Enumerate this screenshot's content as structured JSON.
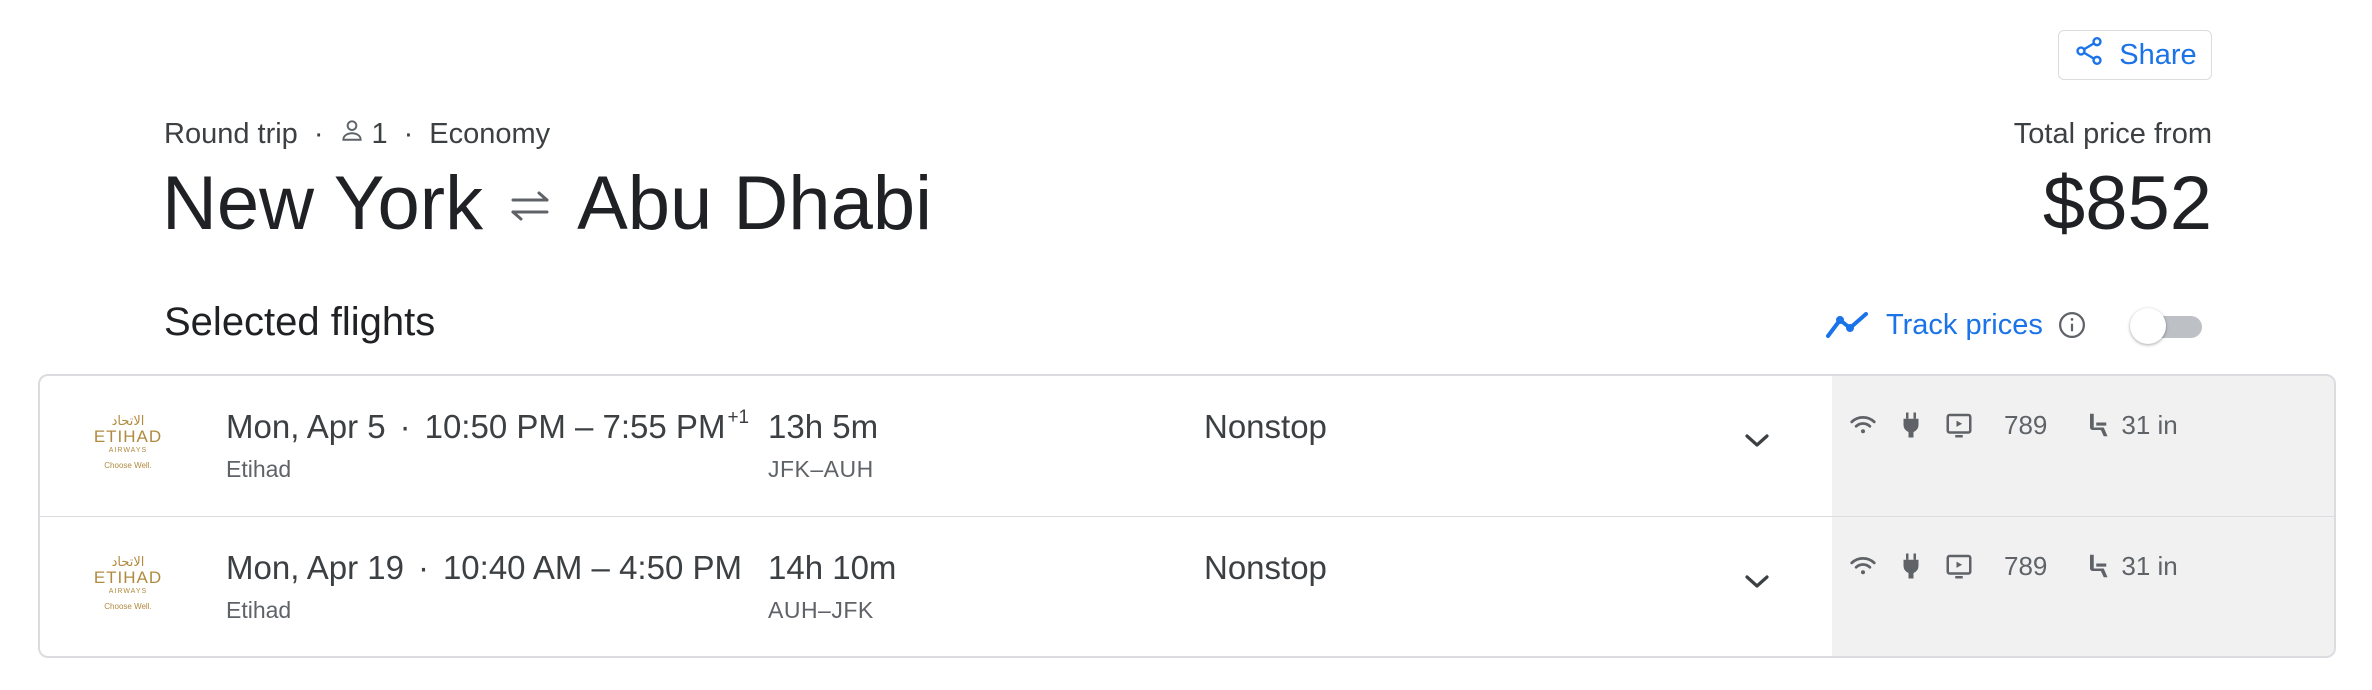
{
  "header": {
    "share_label": "Share",
    "trip_type": "Round trip",
    "passengers": "1",
    "cabin": "Economy",
    "origin": "New York",
    "destination": "Abu Dhabi",
    "total_label": "Total price from",
    "total_price": "$852"
  },
  "section": {
    "title": "Selected flights",
    "track_label": "Track prices",
    "track_enabled": false
  },
  "flights": [
    {
      "logo": {
        "arabic": "الاتحاد",
        "brand": "ETIHAD",
        "sub": "AIRWAYS",
        "tag": "Choose Well."
      },
      "date": "Mon, Apr 5",
      "times": "10:50 PM – 7:55 PM",
      "day_offset": "+1",
      "airline": "Etihad",
      "duration": "13h 5m",
      "route": "JFK–AUH",
      "stops": "Nonstop",
      "aircraft": "789",
      "legroom": "31 in"
    },
    {
      "logo": {
        "arabic": "الاتحاد",
        "brand": "ETIHAD",
        "sub": "AIRWAYS",
        "tag": "Choose Well."
      },
      "date": "Mon, Apr 19",
      "times": "10:40 AM – 4:50 PM",
      "day_offset": "",
      "airline": "Etihad",
      "duration": "14h 10m",
      "route": "AUH–JFK",
      "stops": "Nonstop",
      "aircraft": "789",
      "legroom": "31 in"
    }
  ],
  "colors": {
    "accent": "#1a73e8",
    "panel": "#f1f1f1",
    "logo_gold": "#b08a3e"
  }
}
